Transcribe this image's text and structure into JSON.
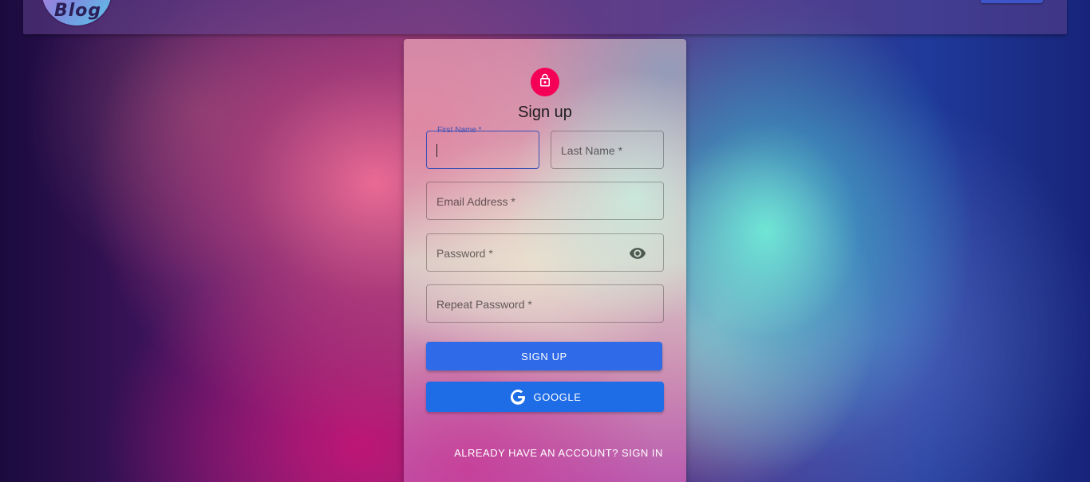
{
  "header": {
    "logo_text": "Blog"
  },
  "form": {
    "title": "Sign up",
    "fields": {
      "first_name": {
        "label": "First Name *",
        "value": ""
      },
      "last_name": {
        "label": "Last Name *",
        "value": ""
      },
      "email": {
        "label": "Email Address *",
        "value": ""
      },
      "password": {
        "label": "Password *",
        "value": ""
      },
      "repeat_password": {
        "label": "Repeat Password *",
        "value": ""
      }
    },
    "signup_button": "SIGN UP",
    "google_button": "GOOGLE",
    "signin_link": "ALREADY HAVE AN ACCOUNT? SIGN IN"
  },
  "icons": {
    "avatar": "lock-icon",
    "password_toggle": "eye-icon",
    "google": "google-icon"
  },
  "colors": {
    "avatar_bg": "#f50057",
    "focus": "#3f51b5",
    "signup_button": "#2f6ae8",
    "google_button": "#1f6de6"
  }
}
